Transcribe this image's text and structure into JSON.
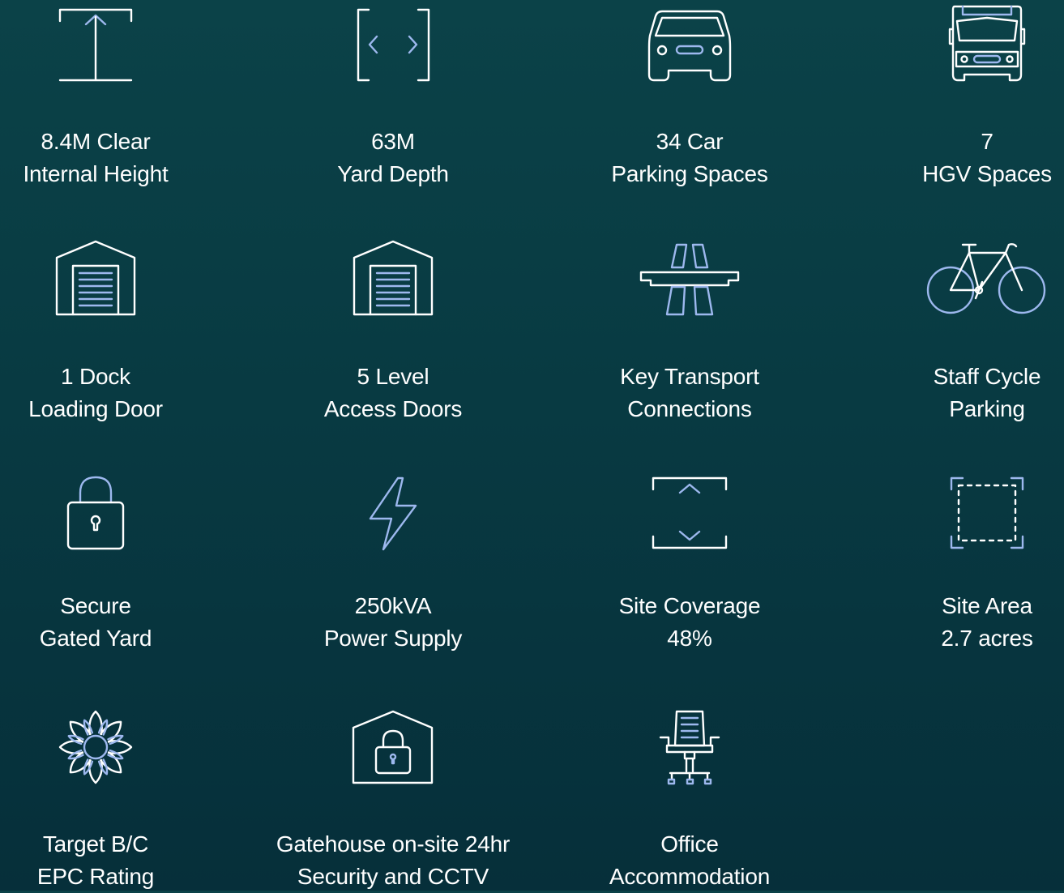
{
  "features": [
    {
      "icon": "clear-height-icon",
      "line1": "8.4M Clear",
      "line2": "Internal Height"
    },
    {
      "icon": "yard-depth-icon",
      "line1": "63M",
      "line2": "Yard Depth"
    },
    {
      "icon": "car-icon",
      "line1": "34 Car",
      "line2": "Parking Spaces"
    },
    {
      "icon": "hgv-truck-icon",
      "line1": "7",
      "line2": "HGV Spaces"
    },
    {
      "icon": "dock-door-icon",
      "line1": "1 Dock",
      "line2": "Loading Door"
    },
    {
      "icon": "level-door-icon",
      "line1": "5 Level",
      "line2": "Access Doors"
    },
    {
      "icon": "motorway-icon",
      "line1": "Key Transport",
      "line2": "Connections"
    },
    {
      "icon": "bicycle-icon",
      "line1": "Staff Cycle",
      "line2": "Parking"
    },
    {
      "icon": "padlock-icon",
      "line1": "Secure",
      "line2": "Gated Yard"
    },
    {
      "icon": "lightning-icon",
      "line1": "250kVA",
      "line2": "Power Supply"
    },
    {
      "icon": "site-coverage-icon",
      "line1": "Site Coverage",
      "line2": "48%"
    },
    {
      "icon": "site-area-icon",
      "line1": "Site Area",
      "line2": "2.7 acres"
    },
    {
      "icon": "flower-icon",
      "line1": "Target B/C",
      "line2": "EPC Rating"
    },
    {
      "icon": "gatehouse-icon",
      "line1": "Gatehouse on-site 24hr",
      "line2": "Security and CCTV"
    },
    {
      "icon": "office-chair-icon",
      "line1": "Office",
      "line2": "Accommodation"
    }
  ],
  "colors": {
    "background_top": "#0b4248",
    "background_bottom": "#062f3a",
    "text": "#ffffff",
    "icon_accent": "#9db8ee"
  }
}
